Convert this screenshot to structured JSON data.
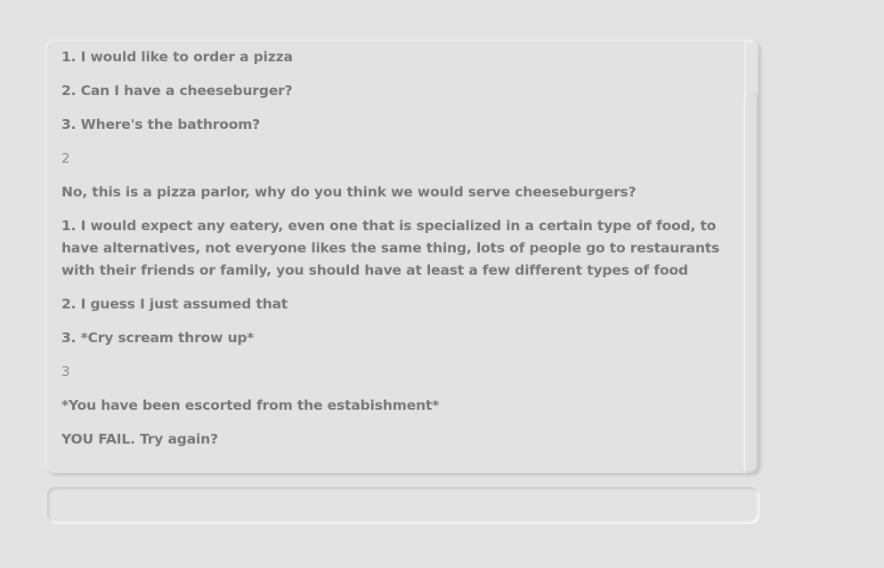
{
  "chat": {
    "lines": [
      {
        "text": "1. I would like to order a pizza",
        "kind": "option"
      },
      {
        "text": "2. Can I have a cheeseburger?",
        "kind": "option"
      },
      {
        "text": "3. Where's the bathroom?",
        "kind": "option"
      },
      {
        "text": "2",
        "kind": "input"
      },
      {
        "text": "No, this is a pizza parlor, why do you think we would serve cheeseburgers?",
        "kind": "response"
      },
      {
        "text": "1. I would expect any eatery, even one that is specialized in a certain type of food, to have alternatives, not everyone likes the same thing, lots of people go to restaurants with their friends or family, you should have at least a few different types of food",
        "kind": "option"
      },
      {
        "text": "2. I guess I just assumed that",
        "kind": "option"
      },
      {
        "text": "3. *Cry scream throw up*",
        "kind": "option"
      },
      {
        "text": "3",
        "kind": "input"
      },
      {
        "text": "*You have been escorted from the estabishment*",
        "kind": "response"
      },
      {
        "text": "YOU FAIL. Try again?",
        "kind": "response"
      }
    ]
  },
  "input": {
    "value": "",
    "placeholder": ""
  }
}
